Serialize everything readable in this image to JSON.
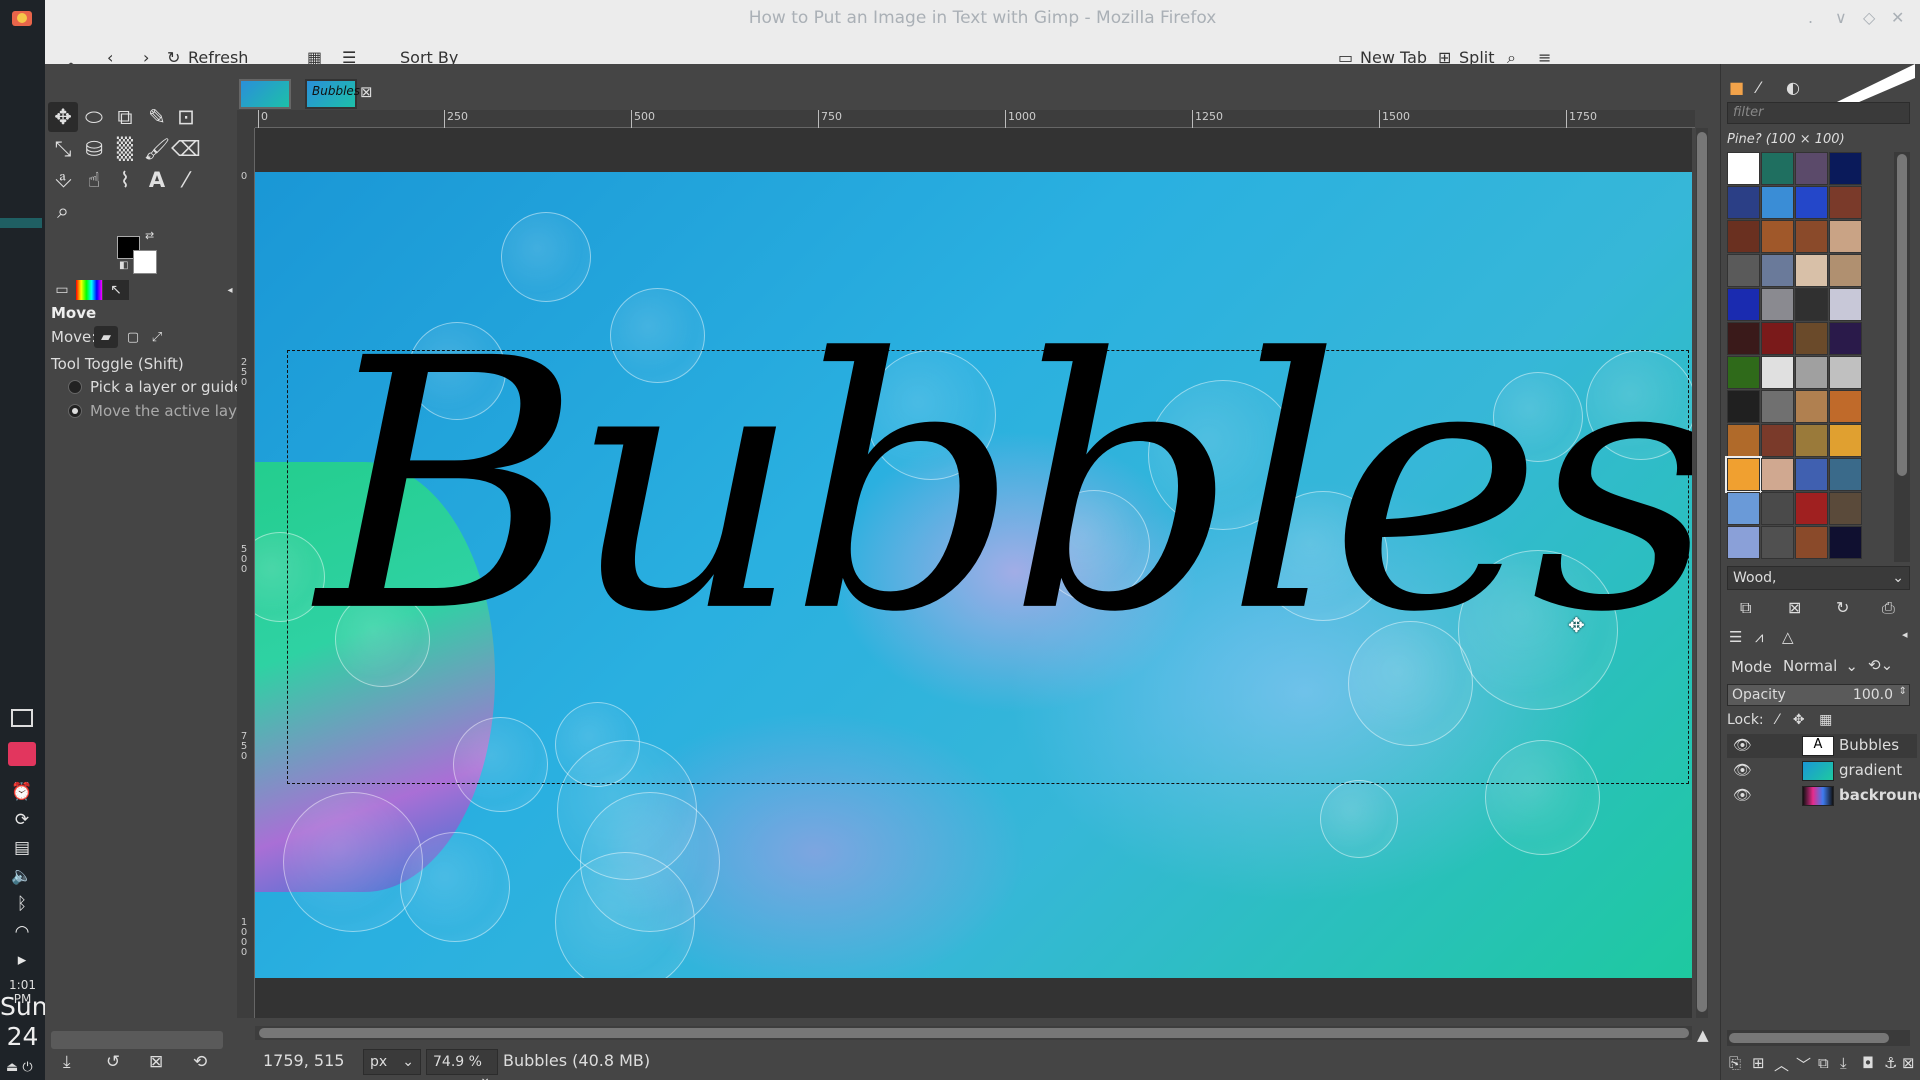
{
  "system_bar": {
    "time": "1:01 PM",
    "day": "Sun",
    "date": "24"
  },
  "browser": {
    "window_title": "How to Put an Image in Text with Gimp - Mozilla Firefox",
    "toolbar": {
      "refresh_label": "Refresh",
      "sort_by_label": "Sort By",
      "new_tab_label": "New Tab",
      "split_label": "Split"
    }
  },
  "gimp": {
    "image_tabs": [
      {
        "label": ""
      },
      {
        "label": "Bubbles"
      }
    ],
    "tool_options": {
      "title": "Move",
      "move_label": "Move:",
      "toggle_label": "Tool Toggle  (Shift)",
      "option_pick": "Pick a layer or guide",
      "option_active": "Move the active laye"
    },
    "ruler_h_ticks": [
      "0",
      "250",
      "500",
      "750",
      "1000",
      "1250",
      "1500",
      "1750"
    ],
    "ruler_v_ticks": [
      "0",
      "250",
      "500",
      "750",
      "1000"
    ],
    "canvas_text": "Bubbles",
    "status": {
      "coords": "1759, 515",
      "unit": "px",
      "zoom": "74.9 %",
      "info": "Bubbles (40.8 MB)"
    },
    "patterns": {
      "filter_placeholder": "filter",
      "current_name": "Pine? (100 × 100)",
      "selected_label": "Wood,"
    },
    "layers": {
      "mode_label": "Mode",
      "mode_value": "Normal",
      "opacity_label": "Opacity",
      "opacity_value": "100.0",
      "lock_label": "Lock:",
      "items": [
        {
          "name": "Bubbles"
        },
        {
          "name": "gradient"
        },
        {
          "name": "backround"
        }
      ]
    }
  }
}
